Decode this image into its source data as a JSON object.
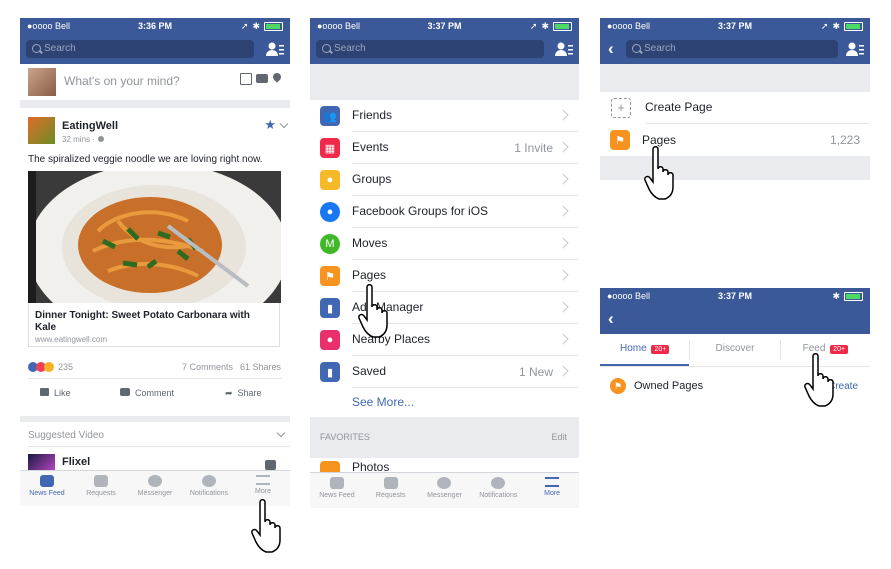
{
  "status": {
    "carrier": "●oooo Bell",
    "wifi": "wifi-icon"
  },
  "screen1": {
    "time": "3:36 PM",
    "search_placeholder": "Search",
    "composer_placeholder": "What's on your mind?",
    "post": {
      "author": "EatingWell",
      "meta": "32 mins · ",
      "text": "The spiralized veggie noodle we are loving right now.",
      "link_title": "Dinner Tonight: Sweet Potato Carbonara with Kale",
      "link_domain": "www.eatingwell.com",
      "reaction_count": "235",
      "comments": "7 Comments",
      "shares": "61 Shares",
      "actions": {
        "like": "Like",
        "comment": "Comment",
        "share": "Share"
      }
    },
    "suggested_label": "Suggested Video",
    "suggested_author": "Flixel"
  },
  "tabbar": [
    {
      "label": "News Feed",
      "icon": "news-feed-icon"
    },
    {
      "label": "Requests",
      "icon": "requests-icon"
    },
    {
      "label": "Messenger",
      "icon": "messenger-icon"
    },
    {
      "label": "Notifications",
      "icon": "globe-icon"
    },
    {
      "label": "More",
      "icon": "more-icon"
    }
  ],
  "screen2": {
    "time": "3:37 PM",
    "search_placeholder": "Search",
    "items": [
      {
        "label": "Friends",
        "meta": "",
        "color": "#4267b2",
        "icon": "friends-icon"
      },
      {
        "label": "Events",
        "meta": "1 Invite",
        "color": "#f02849",
        "icon": "calendar-icon"
      },
      {
        "label": "Groups",
        "meta": "",
        "color": "#f7b928",
        "icon": "groups-icon"
      },
      {
        "label": "Facebook Groups for iOS",
        "meta": "",
        "color": "#1877f2",
        "icon": "groups-app-icon"
      },
      {
        "label": "Moves",
        "meta": "",
        "color": "#42b72a",
        "icon": "moves-icon"
      },
      {
        "label": "Pages",
        "meta": "",
        "color": "#f7931e",
        "icon": "flag-icon"
      },
      {
        "label": "Ads Manager",
        "meta": "",
        "color": "#4267b2",
        "icon": "bar-chart-icon"
      },
      {
        "label": "Nearby Places",
        "meta": "",
        "color": "#e9306a",
        "icon": "pin-icon"
      },
      {
        "label": "Saved",
        "meta": "1 New",
        "color": "#4267b2",
        "icon": "bookmark-icon"
      }
    ],
    "see_more": "See More...",
    "favorites_header": "FAVORITES",
    "favorites_edit": "Edit",
    "favorite_partial": "Photos"
  },
  "screen3": {
    "time": "3:37 PM",
    "search_placeholder": "Search",
    "create_page": "Create Page",
    "pages_label": "Pages",
    "pages_count": "1,223"
  },
  "screen4": {
    "time": "3:37 PM",
    "tabs": [
      {
        "label": "Home",
        "badge": "20+"
      },
      {
        "label": "Discover",
        "badge": ""
      },
      {
        "label": "Feed",
        "badge": "20+"
      }
    ],
    "owned_pages": "Owned Pages",
    "create_partial": "Create"
  }
}
